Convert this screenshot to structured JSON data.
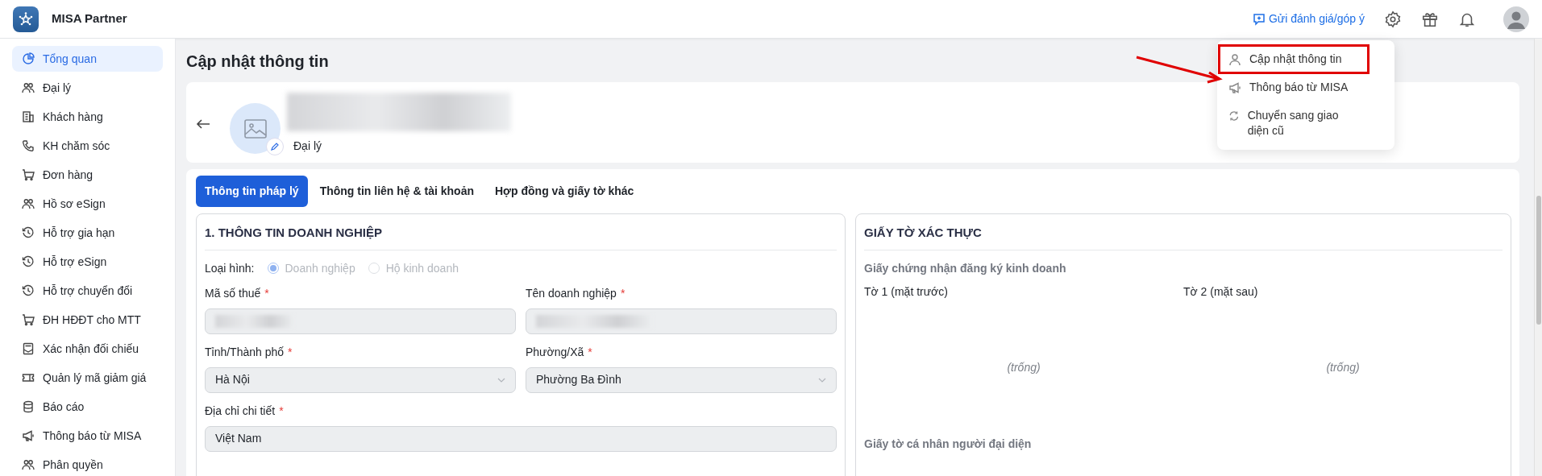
{
  "app": {
    "title": "MISA Partner"
  },
  "topbar": {
    "feedback_link": "Gửi đánh giá/góp ý"
  },
  "user_menu": [
    {
      "label": "Cập nhật thông tin",
      "highlighted": true
    },
    {
      "label": "Thông báo từ MISA",
      "highlighted": false
    },
    {
      "label": "Chuyển sang giao diện cũ",
      "highlighted": false
    }
  ],
  "sidebar": {
    "items": [
      {
        "label": "Tổng quan",
        "selected": true
      },
      {
        "label": "Đại lý",
        "selected": false
      },
      {
        "label": "Khách hàng",
        "selected": false
      },
      {
        "label": "KH chăm sóc",
        "selected": false
      },
      {
        "label": "Đơn hàng",
        "selected": false
      },
      {
        "label": "Hồ sơ eSign",
        "selected": false
      },
      {
        "label": "Hỗ trợ gia hạn",
        "selected": false
      },
      {
        "label": "Hỗ trợ eSign",
        "selected": false
      },
      {
        "label": "Hỗ trợ chuyển đổi",
        "selected": false
      },
      {
        "label": "ĐH HĐĐT cho MTT",
        "selected": false
      },
      {
        "label": "Xác nhận đối chiếu",
        "selected": false
      },
      {
        "label": "Quản lý mã giảm giá",
        "selected": false
      },
      {
        "label": "Báo cáo",
        "selected": false
      },
      {
        "label": "Thông báo từ MISA",
        "selected": false
      },
      {
        "label": "Phân quyền",
        "selected": false
      }
    ]
  },
  "page": {
    "title": "Cập nhật thông tin"
  },
  "profile": {
    "role": "Đại lý"
  },
  "tabs": [
    {
      "label": "Thông tin pháp lý",
      "selected": true
    },
    {
      "label": "Thông tin liên hệ & tài khoản",
      "selected": false
    },
    {
      "label": "Hợp đồng và giấy tờ khác",
      "selected": false
    }
  ],
  "business_info": {
    "title": "1. THÔNG TIN DOANH NGHIỆP",
    "type_label": "Loại hình:",
    "type_options": [
      {
        "label": "Doanh nghiệp",
        "checked": true,
        "disabled": true
      },
      {
        "label": "Hộ kinh doanh",
        "checked": false,
        "disabled": true
      }
    ],
    "fields": [
      {
        "label": "Mã số thuế",
        "required_mark": "*",
        "kind": "redacted"
      },
      {
        "label": "Tên doanh nghiệp",
        "required_mark": "*",
        "kind": "redacted"
      },
      {
        "label": "Tỉnh/Thành phố",
        "required_mark": "*",
        "kind": "select",
        "value": "Hà Nội"
      },
      {
        "label": "Phường/Xã",
        "required_mark": "*",
        "kind": "select",
        "value": "Phường Ba Đình"
      },
      {
        "label": "Địa chỉ chi tiết",
        "required_mark": "*",
        "kind": "wide",
        "value": "Việt Nam"
      }
    ]
  },
  "documents": {
    "title": "GIẤY TỜ XÁC THỰC",
    "group_title": "Giấy chứng nhận đăng ký kinh doanh",
    "sheets": [
      {
        "label": "Tờ 1 (mặt trước)",
        "content": "(trống)"
      },
      {
        "label": "Tờ 2 (mặt sau)",
        "content": "(trống)"
      }
    ],
    "next_group_title": "Giấy tờ cá nhân người đại diện"
  }
}
